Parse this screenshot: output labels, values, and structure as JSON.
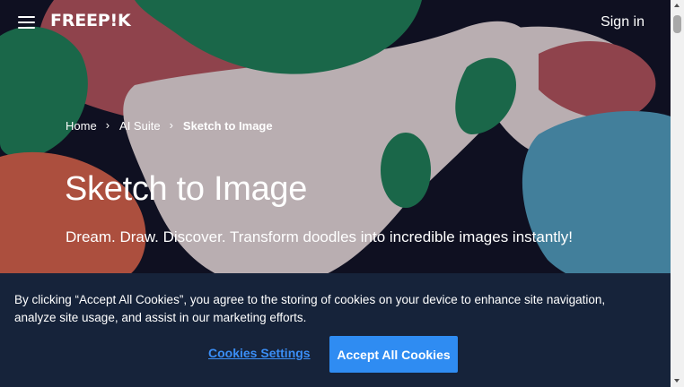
{
  "header": {
    "logo_text": "FREEP!K",
    "signin_label": "Sign in"
  },
  "breadcrumb": {
    "items": [
      "Home",
      "AI Suite",
      "Sketch to Image"
    ],
    "separator": "›"
  },
  "hero": {
    "title": "Sketch to Image",
    "subtitle": "Dream. Draw. Discover. Transform doodles into incredible images instantly!"
  },
  "cookie_banner": {
    "text": "By clicking “Accept All Cookies”, you agree to the storing of cookies on your device to enhance site navigation, analyze site usage, and assist in our marketing efforts.",
    "settings_label": "Cookies Settings",
    "accept_label": "Accept All Cookies"
  },
  "colors": {
    "hero_dark": "#0f1121",
    "shape_green": "#1d7a52",
    "shape_red": "#ab4f56",
    "shape_pink": "#ded1d1",
    "shape_orange": "#cf5d45",
    "shape_blue": "#4e98b6",
    "cookie_banner_bg": "#16233a",
    "accent_blue": "#2f8cf2"
  },
  "icons": {
    "menu": "hamburger-icon",
    "breadcrumb_separator": "chevron-right-icon"
  }
}
